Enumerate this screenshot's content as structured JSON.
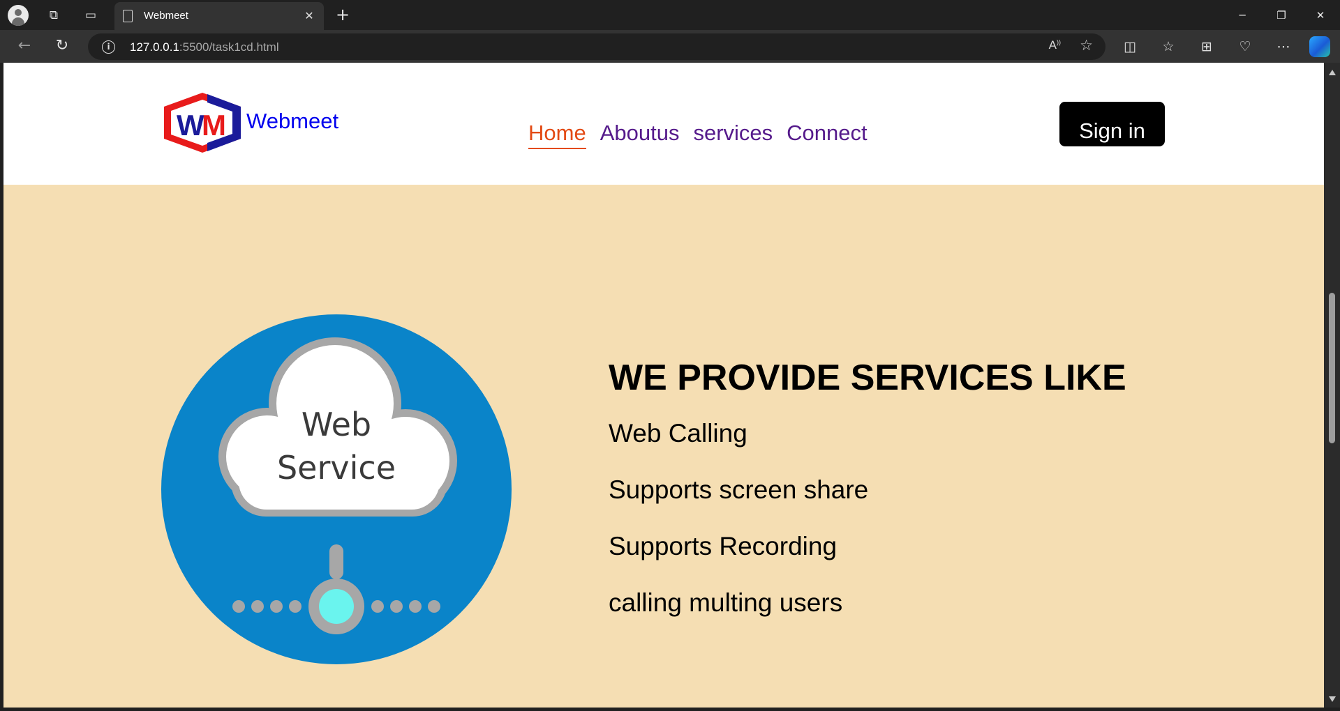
{
  "browser": {
    "tab_title": "Webmeet",
    "url_host": "127.0.0.1",
    "url_rest": ":5500/task1cd.html"
  },
  "site": {
    "brand": "Webmeet",
    "logo_text": "WM",
    "nav": [
      {
        "label": "Home",
        "active": true
      },
      {
        "label": "Aboutus",
        "active": false
      },
      {
        "label": "services",
        "active": false
      },
      {
        "label": "Connect",
        "active": false
      }
    ],
    "signin_label": "Sign in"
  },
  "services": {
    "graphic_text_line1": "Web",
    "graphic_text_line2": "Service",
    "heading": "WE PROVIDE SERVICES LIKE",
    "items": [
      "Web Calling",
      "Supports screen share",
      "Supports Recording",
      "calling multing users"
    ]
  },
  "colors": {
    "section_bg": "#f5deb3",
    "circle_blue": "#0a84c9",
    "nav_active": "#e34a14",
    "nav_visited": "#551a8b",
    "brand_blue": "#0000ee"
  }
}
